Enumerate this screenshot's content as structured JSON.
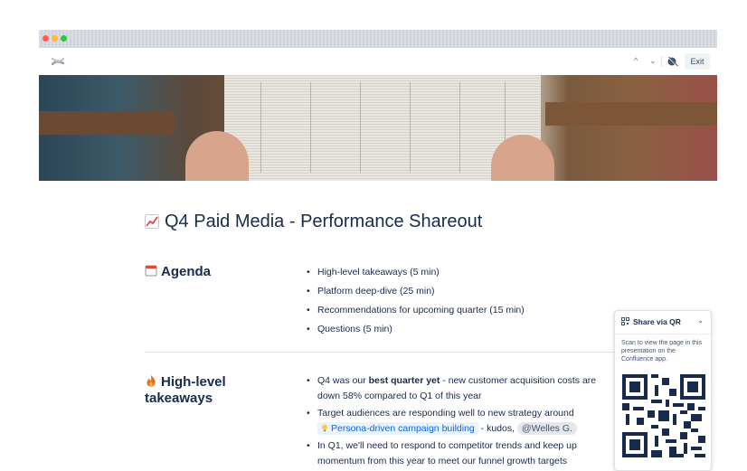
{
  "toolbar": {
    "exit_label": "Exit",
    "up_chevron": "^",
    "down_chevron": "⌄"
  },
  "slide": {
    "title": "Q4 Paid Media - Performance Shareout",
    "agenda": {
      "heading": "Agenda",
      "items": [
        "High-level takeaways (5 min)",
        "Platform deep-dive (25 min)",
        "Recommendations for upcoming quarter (15 min)",
        "Questions (5 min)"
      ]
    },
    "takeaways": {
      "heading_line1": "High-level",
      "heading_line2": "takeaways",
      "item1_pre": "Q4 was our ",
      "item1_bold": "best quarter yet",
      "item1_post": " - new customer acquisition costs are down 58% compared to Q1 of this year",
      "item2_pre": "Target audiences are responding well to new strategy around",
      "item2_link": "Persona-driven campaign building",
      "item2_mid": " - kudos, ",
      "item2_mention": "@Welles G.",
      "item3": "In Q1, we'll need to respond to competitor trends and keep up momentum from this year to meet our funnel growth targets"
    }
  },
  "qr_panel": {
    "title": "Share via QR",
    "description": "Scan to view the page in this presentation on the Confluence app."
  },
  "icons": {
    "logo": "confluence-logo-icon",
    "title_emoji": "chart-increasing-icon",
    "agenda_emoji": "calendar-icon",
    "takeaways_emoji": "fire-icon",
    "link_emoji": "lightbulb-icon"
  },
  "colors": {
    "text": "#172b4d",
    "link": "#0c66e4",
    "link_bg": "#e9f2ff"
  }
}
